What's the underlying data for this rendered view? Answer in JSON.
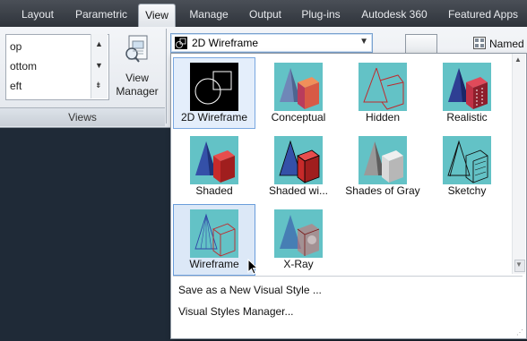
{
  "ribbon_tabs": [
    {
      "label": "Layout"
    },
    {
      "label": "Parametric"
    },
    {
      "label": "View"
    },
    {
      "label": "Manage"
    },
    {
      "label": "Output"
    },
    {
      "label": "Plug-ins"
    },
    {
      "label": "Autodesk 360"
    },
    {
      "label": "Featured Apps"
    }
  ],
  "views_panel": {
    "list_items": [
      "op",
      "ottom",
      "eft"
    ],
    "view_manager_label_line1": "View",
    "view_manager_label_line2": "Manager",
    "panel_title": "Views"
  },
  "named_label": "Named",
  "visual_style_combo": {
    "current": "2D Wireframe"
  },
  "gallery": {
    "items": [
      {
        "label": "2D Wireframe",
        "icon": "2d-wireframe-icon"
      },
      {
        "label": "Conceptual",
        "icon": "conceptual-icon"
      },
      {
        "label": "Hidden",
        "icon": "hidden-icon"
      },
      {
        "label": "Realistic",
        "icon": "realistic-icon"
      },
      {
        "label": "Shaded",
        "icon": "shaded-icon"
      },
      {
        "label": "Shaded wi...",
        "icon": "shaded-with-edges-icon"
      },
      {
        "label": "Shades of Gray",
        "icon": "shades-of-gray-icon"
      },
      {
        "label": "Sketchy",
        "icon": "sketchy-icon"
      },
      {
        "label": "Wireframe",
        "icon": "wireframe-icon"
      },
      {
        "label": "X-Ray",
        "icon": "x-ray-icon"
      }
    ],
    "selected": "2D Wireframe",
    "hovered": "Wireframe"
  },
  "menu": {
    "save_new": "Save as a New Visual Style ...",
    "manager": "Visual Styles Manager..."
  },
  "colors": {
    "thumb_bg": "#63c2c6",
    "cone": "#2f47a6",
    "cube": "#c0292c",
    "selection": "#7aa8e0"
  }
}
